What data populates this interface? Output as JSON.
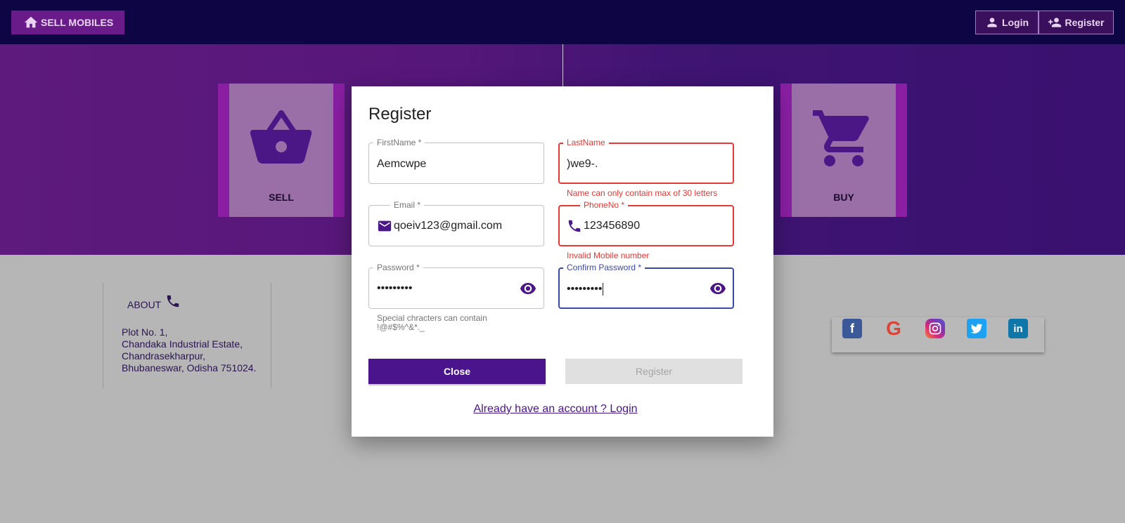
{
  "topbar": {
    "brand_label": "SELL MOBILES",
    "login_label": "Login",
    "register_label": "Register"
  },
  "hero": {
    "sell_label": "SELL",
    "buy_label": "BUY"
  },
  "footer": {
    "about_title": "ABOUT",
    "address": [
      "Plot No. 1,",
      "Chandaka Industrial Estate,",
      "Chandrasekharpur,",
      "Bhubaneswar, Odisha 751024."
    ],
    "social": [
      "facebook-icon",
      "google-icon",
      "instagram-icon",
      "twitter-icon",
      "linkedin-icon"
    ]
  },
  "modal": {
    "title": "Register",
    "first_name": {
      "label": "FirstName *",
      "value": "Aemcwpe"
    },
    "last_name": {
      "label": "LastName",
      "value": ")we9-.",
      "error": "Name can only contain max of 30 letters"
    },
    "email": {
      "label": "Email *",
      "value": "qoeiv123@gmail.com"
    },
    "phone": {
      "label": "PhoneNo *",
      "value": "123456890",
      "error": "Invalid Mobile number"
    },
    "password": {
      "label": "Password *",
      "value": "•••••••••",
      "helper_line1": "Special chracters can contain",
      "helper_line2": "!@#$%^&*._"
    },
    "confirm_password": {
      "label": "Confirm Password *",
      "value": "•••••••••"
    },
    "close_label": "Close",
    "register_label": "Register",
    "login_link": "Already have an account ? Login"
  },
  "colors": {
    "topbar": "#0d0544",
    "accent": "#4a148c",
    "error": "#e53935",
    "focus": "#3949ab"
  }
}
